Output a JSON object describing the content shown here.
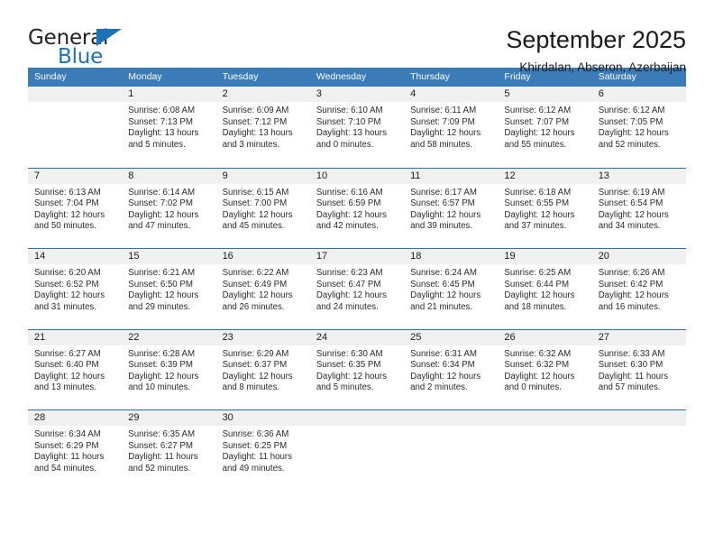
{
  "brand": {
    "word_one": "General",
    "word_two": "Blue",
    "triangle_icon": "blue-triangle-logo-mark"
  },
  "header": {
    "month_title": "September 2025",
    "location": "Khirdalan, Abseron, Azerbaijan"
  },
  "colors": {
    "header_blue": "#3b7cb8",
    "row_divider_blue": "#2f6fae",
    "date_band_gray": "#f0f0f0",
    "brand_blue": "#1c72b8",
    "text": "#1a1a1a"
  },
  "calendar": {
    "weekdays": [
      "Sunday",
      "Monday",
      "Tuesday",
      "Wednesday",
      "Thursday",
      "Friday",
      "Saturday"
    ],
    "weeks": [
      [
        {
          "day": "",
          "sunrise": "",
          "sunset": "",
          "daylight_line1": "",
          "daylight_line2": "",
          "empty": true
        },
        {
          "day": "1",
          "sunrise": "Sunrise: 6:08 AM",
          "sunset": "Sunset: 7:13 PM",
          "daylight_line1": "Daylight: 13 hours",
          "daylight_line2": "and 5 minutes."
        },
        {
          "day": "2",
          "sunrise": "Sunrise: 6:09 AM",
          "sunset": "Sunset: 7:12 PM",
          "daylight_line1": "Daylight: 13 hours",
          "daylight_line2": "and 3 minutes."
        },
        {
          "day": "3",
          "sunrise": "Sunrise: 6:10 AM",
          "sunset": "Sunset: 7:10 PM",
          "daylight_line1": "Daylight: 13 hours",
          "daylight_line2": "and 0 minutes."
        },
        {
          "day": "4",
          "sunrise": "Sunrise: 6:11 AM",
          "sunset": "Sunset: 7:09 PM",
          "daylight_line1": "Daylight: 12 hours",
          "daylight_line2": "and 58 minutes."
        },
        {
          "day": "5",
          "sunrise": "Sunrise: 6:12 AM",
          "sunset": "Sunset: 7:07 PM",
          "daylight_line1": "Daylight: 12 hours",
          "daylight_line2": "and 55 minutes."
        },
        {
          "day": "6",
          "sunrise": "Sunrise: 6:12 AM",
          "sunset": "Sunset: 7:05 PM",
          "daylight_line1": "Daylight: 12 hours",
          "daylight_line2": "and 52 minutes."
        }
      ],
      [
        {
          "day": "7",
          "sunrise": "Sunrise: 6:13 AM",
          "sunset": "Sunset: 7:04 PM",
          "daylight_line1": "Daylight: 12 hours",
          "daylight_line2": "and 50 minutes."
        },
        {
          "day": "8",
          "sunrise": "Sunrise: 6:14 AM",
          "sunset": "Sunset: 7:02 PM",
          "daylight_line1": "Daylight: 12 hours",
          "daylight_line2": "and 47 minutes."
        },
        {
          "day": "9",
          "sunrise": "Sunrise: 6:15 AM",
          "sunset": "Sunset: 7:00 PM",
          "daylight_line1": "Daylight: 12 hours",
          "daylight_line2": "and 45 minutes."
        },
        {
          "day": "10",
          "sunrise": "Sunrise: 6:16 AM",
          "sunset": "Sunset: 6:59 PM",
          "daylight_line1": "Daylight: 12 hours",
          "daylight_line2": "and 42 minutes."
        },
        {
          "day": "11",
          "sunrise": "Sunrise: 6:17 AM",
          "sunset": "Sunset: 6:57 PM",
          "daylight_line1": "Daylight: 12 hours",
          "daylight_line2": "and 39 minutes."
        },
        {
          "day": "12",
          "sunrise": "Sunrise: 6:18 AM",
          "sunset": "Sunset: 6:55 PM",
          "daylight_line1": "Daylight: 12 hours",
          "daylight_line2": "and 37 minutes."
        },
        {
          "day": "13",
          "sunrise": "Sunrise: 6:19 AM",
          "sunset": "Sunset: 6:54 PM",
          "daylight_line1": "Daylight: 12 hours",
          "daylight_line2": "and 34 minutes."
        }
      ],
      [
        {
          "day": "14",
          "sunrise": "Sunrise: 6:20 AM",
          "sunset": "Sunset: 6:52 PM",
          "daylight_line1": "Daylight: 12 hours",
          "daylight_line2": "and 31 minutes."
        },
        {
          "day": "15",
          "sunrise": "Sunrise: 6:21 AM",
          "sunset": "Sunset: 6:50 PM",
          "daylight_line1": "Daylight: 12 hours",
          "daylight_line2": "and 29 minutes."
        },
        {
          "day": "16",
          "sunrise": "Sunrise: 6:22 AM",
          "sunset": "Sunset: 6:49 PM",
          "daylight_line1": "Daylight: 12 hours",
          "daylight_line2": "and 26 minutes."
        },
        {
          "day": "17",
          "sunrise": "Sunrise: 6:23 AM",
          "sunset": "Sunset: 6:47 PM",
          "daylight_line1": "Daylight: 12 hours",
          "daylight_line2": "and 24 minutes."
        },
        {
          "day": "18",
          "sunrise": "Sunrise: 6:24 AM",
          "sunset": "Sunset: 6:45 PM",
          "daylight_line1": "Daylight: 12 hours",
          "daylight_line2": "and 21 minutes."
        },
        {
          "day": "19",
          "sunrise": "Sunrise: 6:25 AM",
          "sunset": "Sunset: 6:44 PM",
          "daylight_line1": "Daylight: 12 hours",
          "daylight_line2": "and 18 minutes."
        },
        {
          "day": "20",
          "sunrise": "Sunrise: 6:26 AM",
          "sunset": "Sunset: 6:42 PM",
          "daylight_line1": "Daylight: 12 hours",
          "daylight_line2": "and 16 minutes."
        }
      ],
      [
        {
          "day": "21",
          "sunrise": "Sunrise: 6:27 AM",
          "sunset": "Sunset: 6:40 PM",
          "daylight_line1": "Daylight: 12 hours",
          "daylight_line2": "and 13 minutes."
        },
        {
          "day": "22",
          "sunrise": "Sunrise: 6:28 AM",
          "sunset": "Sunset: 6:39 PM",
          "daylight_line1": "Daylight: 12 hours",
          "daylight_line2": "and 10 minutes."
        },
        {
          "day": "23",
          "sunrise": "Sunrise: 6:29 AM",
          "sunset": "Sunset: 6:37 PM",
          "daylight_line1": "Daylight: 12 hours",
          "daylight_line2": "and 8 minutes."
        },
        {
          "day": "24",
          "sunrise": "Sunrise: 6:30 AM",
          "sunset": "Sunset: 6:35 PM",
          "daylight_line1": "Daylight: 12 hours",
          "daylight_line2": "and 5 minutes."
        },
        {
          "day": "25",
          "sunrise": "Sunrise: 6:31 AM",
          "sunset": "Sunset: 6:34 PM",
          "daylight_line1": "Daylight: 12 hours",
          "daylight_line2": "and 2 minutes."
        },
        {
          "day": "26",
          "sunrise": "Sunrise: 6:32 AM",
          "sunset": "Sunset: 6:32 PM",
          "daylight_line1": "Daylight: 12 hours",
          "daylight_line2": "and 0 minutes."
        },
        {
          "day": "27",
          "sunrise": "Sunrise: 6:33 AM",
          "sunset": "Sunset: 6:30 PM",
          "daylight_line1": "Daylight: 11 hours",
          "daylight_line2": "and 57 minutes."
        }
      ],
      [
        {
          "day": "28",
          "sunrise": "Sunrise: 6:34 AM",
          "sunset": "Sunset: 6:29 PM",
          "daylight_line1": "Daylight: 11 hours",
          "daylight_line2": "and 54 minutes."
        },
        {
          "day": "29",
          "sunrise": "Sunrise: 6:35 AM",
          "sunset": "Sunset: 6:27 PM",
          "daylight_line1": "Daylight: 11 hours",
          "daylight_line2": "and 52 minutes."
        },
        {
          "day": "30",
          "sunrise": "Sunrise: 6:36 AM",
          "sunset": "Sunset: 6:25 PM",
          "daylight_line1": "Daylight: 11 hours",
          "daylight_line2": "and 49 minutes."
        },
        {
          "day": "",
          "sunrise": "",
          "sunset": "",
          "daylight_line1": "",
          "daylight_line2": "",
          "empty": true
        },
        {
          "day": "",
          "sunrise": "",
          "sunset": "",
          "daylight_line1": "",
          "daylight_line2": "",
          "empty": true
        },
        {
          "day": "",
          "sunrise": "",
          "sunset": "",
          "daylight_line1": "",
          "daylight_line2": "",
          "empty": true
        },
        {
          "day": "",
          "sunrise": "",
          "sunset": "",
          "daylight_line1": "",
          "daylight_line2": "",
          "empty": true
        }
      ]
    ]
  }
}
